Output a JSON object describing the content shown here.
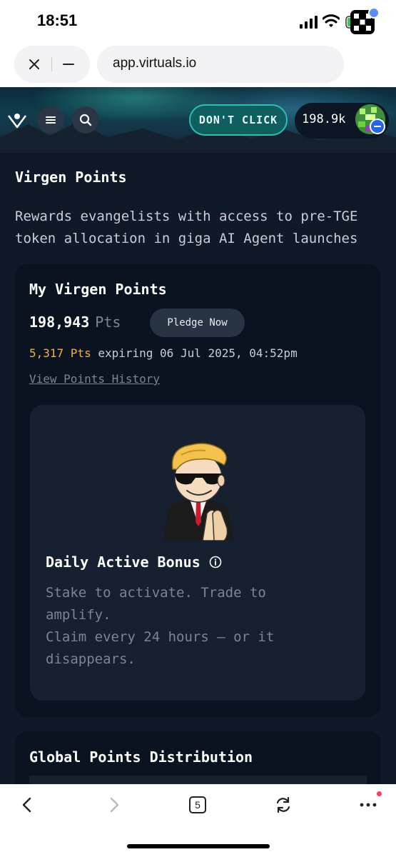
{
  "status_bar": {
    "time": "18:51"
  },
  "browser": {
    "url": "app.virtuals.io",
    "tab_count": "5"
  },
  "header": {
    "dont_click_label": "DON'T CLICK",
    "points_short": "198.9k"
  },
  "section": {
    "title": "Virgen Points",
    "description_line1": "Rewards evangelists with access to pre-TGE",
    "description_line2": "token allocation in giga AI Agent launches"
  },
  "my_points": {
    "title": "My Virgen Points",
    "value": "198,943",
    "unit": "Pts",
    "pledge_label": "Pledge Now",
    "expiring_amount": "5,317 Pts",
    "expiring_text": "expiring 06 Jul 2025, 04:52pm",
    "history_link": "View Points History"
  },
  "daily_bonus": {
    "title": "Daily Active Bonus",
    "line1": "Stake to activate. Trade to",
    "line2": "amplify.",
    "line3": "Claim every 24 hours — or it",
    "line4": "disappears."
  },
  "global": {
    "title": "Global Points Distribution"
  },
  "colors": {
    "accent_teal": "#2fbfae",
    "expiring_orange": "#f2b33d",
    "background": "#111827"
  }
}
